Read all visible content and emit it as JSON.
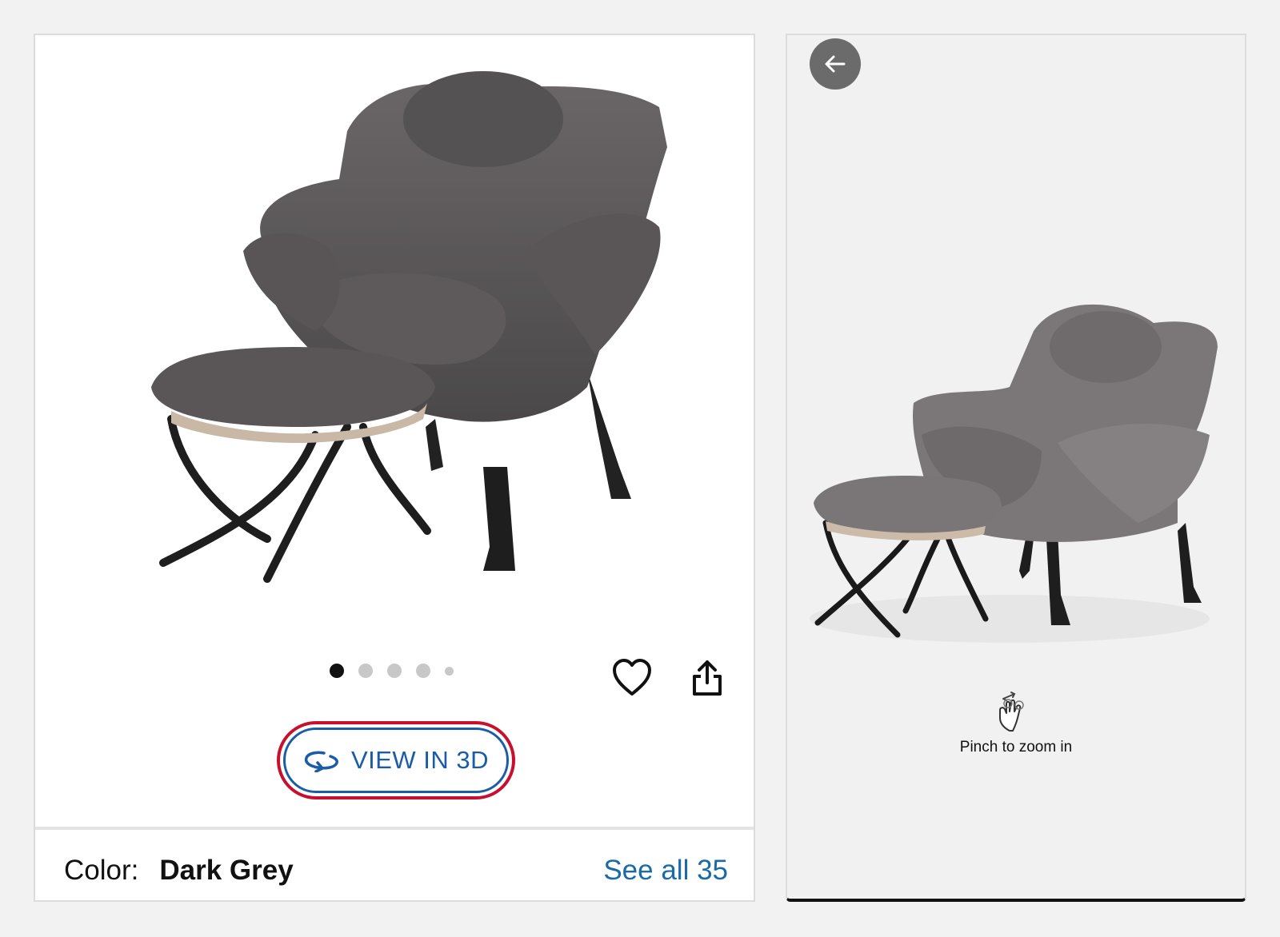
{
  "left_panel": {
    "carousel": {
      "total": 5,
      "active_index": 0
    },
    "view3d": {
      "label": "VIEW IN 3D",
      "highlight_color": "#c8102e",
      "accent": "#1a5da6"
    },
    "color": {
      "label": "Color:",
      "value": "Dark Grey",
      "see_all": "See all 35"
    },
    "icons": {
      "favorite": "heart-icon",
      "share": "share-icon",
      "rotate": "rotate-3d-icon"
    }
  },
  "right_panel": {
    "back_icon": "arrow-left-icon",
    "hint_icon": "pinch-gesture-icon",
    "hint": "Pinch to zoom in"
  }
}
